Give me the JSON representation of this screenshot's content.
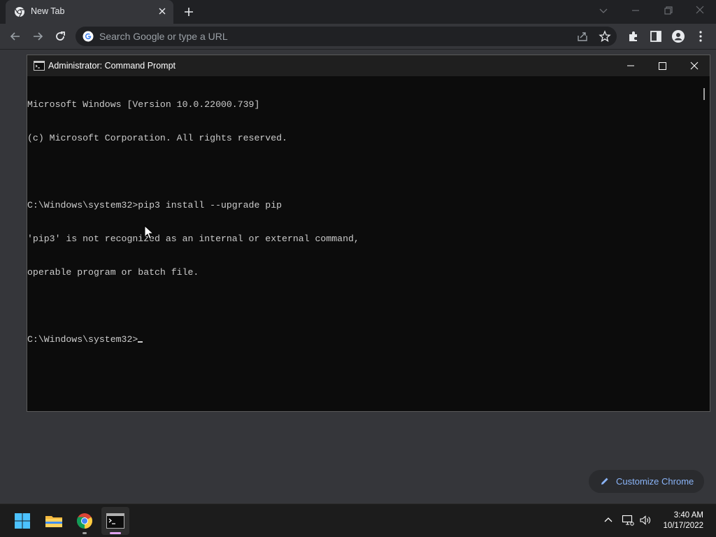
{
  "browser": {
    "tab_title": "New Tab",
    "omnibox_placeholder": "Search Google or type a URL",
    "customize_label": "Customize Chrome"
  },
  "cmd": {
    "window_title": "Administrator: Command Prompt",
    "lines": [
      "Microsoft Windows [Version 10.0.22000.739]",
      "(c) Microsoft Corporation. All rights reserved.",
      "",
      "C:\\Windows\\system32>pip3 install --upgrade pip",
      "'pip3' is not recognized as an internal or external command,",
      "operable program or batch file.",
      ""
    ],
    "prompt": "C:\\Windows\\system32>"
  },
  "taskbar": {
    "apps": [
      "start-icon",
      "file-explorer-icon",
      "chrome-icon",
      "terminal-icon"
    ],
    "time": "3:40 AM",
    "date": "10/17/2022"
  },
  "colors": {
    "chrome_frame": "#202124",
    "chrome_toolbar": "#35363a",
    "console_bg": "#0c0c0c",
    "console_text": "#cccccc",
    "accent_link": "#8ab4f8",
    "taskbar": "#1c1c1c"
  }
}
